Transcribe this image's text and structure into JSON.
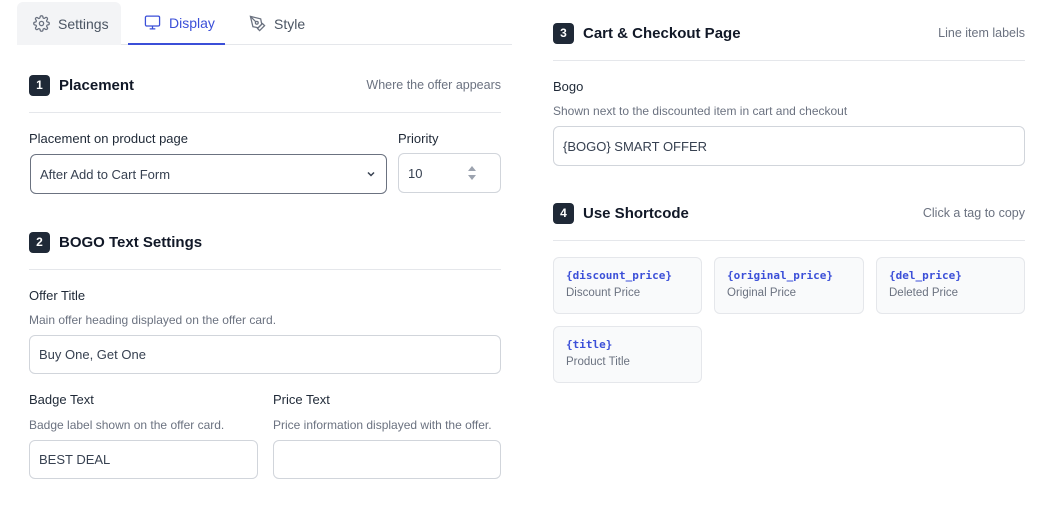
{
  "tabs": [
    {
      "label": "Settings",
      "icon": "gear-icon"
    },
    {
      "label": "Display",
      "icon": "monitor-icon",
      "active": true
    },
    {
      "label": "Style",
      "icon": "pen-tool-icon"
    }
  ],
  "placement": {
    "number": "1",
    "title": "Placement",
    "hint": "Where the offer appears",
    "field_label": "Placement on product page",
    "field_value": "After Add to Cart Form",
    "priority_label": "Priority",
    "priority_value": "10"
  },
  "bogo_text": {
    "number": "2",
    "title": "BOGO Text Settings",
    "offer_title_label": "Offer Title",
    "offer_title_help": "Main offer heading displayed on the offer card.",
    "offer_title_value": "Buy One, Get One",
    "badge_label": "Badge Text",
    "badge_help": "Badge label shown on the offer card.",
    "badge_value": "BEST DEAL",
    "price_label": "Price Text",
    "price_help": "Price information displayed with the offer.",
    "price_value": ""
  },
  "cart": {
    "number": "3",
    "title": "Cart & Checkout Page",
    "hint": "Line item labels",
    "bogo_label": "Bogo",
    "bogo_help": "Shown next to the discounted item in cart and checkout",
    "bogo_value": "{BOGO} SMART OFFER"
  },
  "shortcode": {
    "number": "4",
    "title": "Use Shortcode",
    "hint": "Click a tag to copy",
    "tags": [
      {
        "code": "{discount_price}",
        "desc": "Discount Price"
      },
      {
        "code": "{original_price}",
        "desc": "Original Price"
      },
      {
        "code": "{del_price}",
        "desc": "Deleted Price"
      },
      {
        "code": "{title}",
        "desc": "Product Title"
      }
    ]
  },
  "colors": {
    "accent": "#3b4fd8",
    "badge": "#1f2937",
    "border": "#d1d5db"
  }
}
